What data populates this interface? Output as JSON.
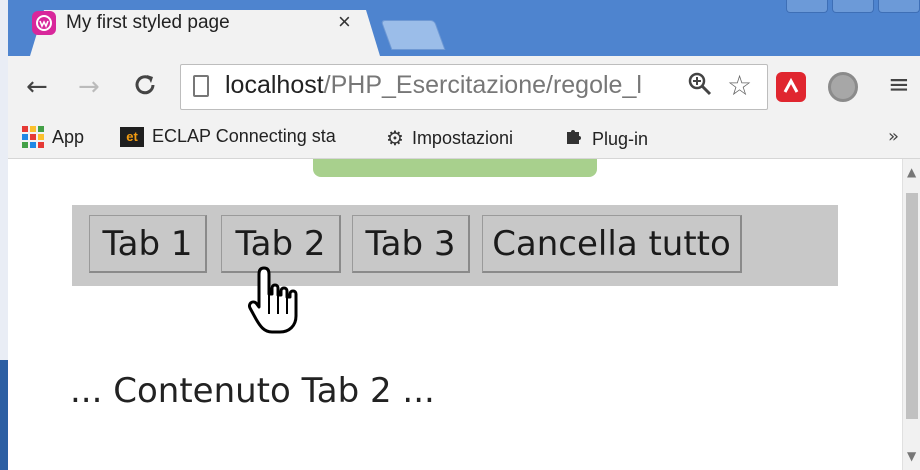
{
  "browser": {
    "tab_title": "My first styled page",
    "tab_close": "×",
    "url_host": "localhost",
    "url_path": "/PHP_Esercitazione/regole_l",
    "bookmarks": {
      "apps": "App",
      "eclap": "ECLAP Connecting sta",
      "settings": "Impostazioni",
      "plugins": "Plug-in",
      "more": "»"
    }
  },
  "page": {
    "tabs": [
      "Tab 1",
      "Tab 2",
      "Tab 3",
      "Cancella tutto"
    ],
    "content": "... Contenuto Tab 2 ..."
  },
  "colors": {
    "tab_strip": "#4e84cf",
    "tab_bar_bg": "#c8c8c8",
    "green_box": "#a8d08d",
    "avira_red": "#e0262f"
  },
  "icons": [
    "back-arrow-icon",
    "forward-arrow-icon",
    "reload-icon",
    "page-icon",
    "zoom-icon",
    "star-icon",
    "avira-icon",
    "extension-icon",
    "menu-icon",
    "apps-icon",
    "gear-icon",
    "puzzle-icon",
    "hand-cursor-icon"
  ]
}
